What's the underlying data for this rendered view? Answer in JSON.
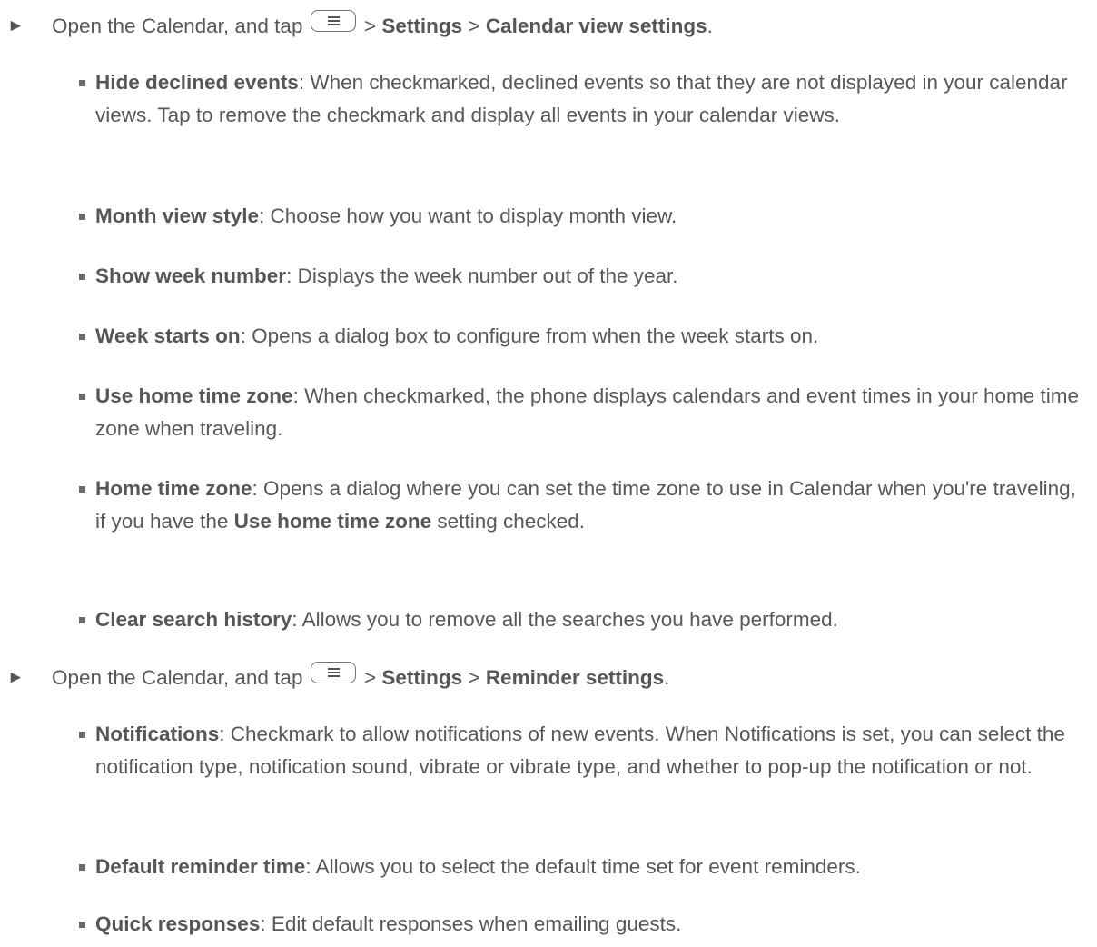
{
  "sections": [
    {
      "step": {
        "arrow": "►",
        "prefix": "Open the Calendar, and tap",
        "sep1": " > ",
        "menu1": "Settings",
        "sep2": " > ",
        "menu2": "Calendar view settings",
        "end": ".",
        "key_icon": "menu-key-icon"
      },
      "items": [
        {
          "term": "Hide declined events",
          "desc": ": When checkmarked, declined events so that they are not displayed in your calendar views. Tap to remove the checkmark and display all events in your calendar views."
        },
        {
          "term": "Month view style",
          "desc": ": Choose how you want to display month view."
        },
        {
          "term": "Show week number",
          "desc": ": Displays the week number out of the year."
        },
        {
          "term": "Week starts on",
          "desc": ": Opens a dialog box to configure from when the week starts on."
        },
        {
          "term": "Use home time zone",
          "desc": ": When checkmarked, the phone displays calendars and event times in your home time zone when traveling."
        },
        {
          "term": "Home time zone",
          "desc": ": Opens a dialog where you can set the time zone to use in Calendar when you're traveling, if you have the ",
          "term2": "Use home time zone",
          "desc2": " setting checked."
        },
        {
          "term": "Clear search history",
          "desc": ": Allows you to remove all the searches you have performed."
        }
      ]
    },
    {
      "step": {
        "arrow": "►",
        "prefix": "Open the Calendar, and tap",
        "sep1": " > ",
        "menu1": "Settings",
        "sep2": " > ",
        "menu2": "Reminder settings",
        "end": ".",
        "key_icon": "menu-key-icon"
      },
      "items": [
        {
          "term": "Notifications",
          "desc": ": Checkmark to allow notifications of new events. When Notifications is set, you can select the notification type, notification sound, vibrate or vibrate type, and whether to pop-up the notification or not."
        },
        {
          "term": "Default reminder time",
          "desc": ": Allows you to select the default time set for event reminders."
        },
        {
          "term": "Quick responses",
          "desc": ": Edit default responses when emailing guests."
        }
      ]
    }
  ]
}
